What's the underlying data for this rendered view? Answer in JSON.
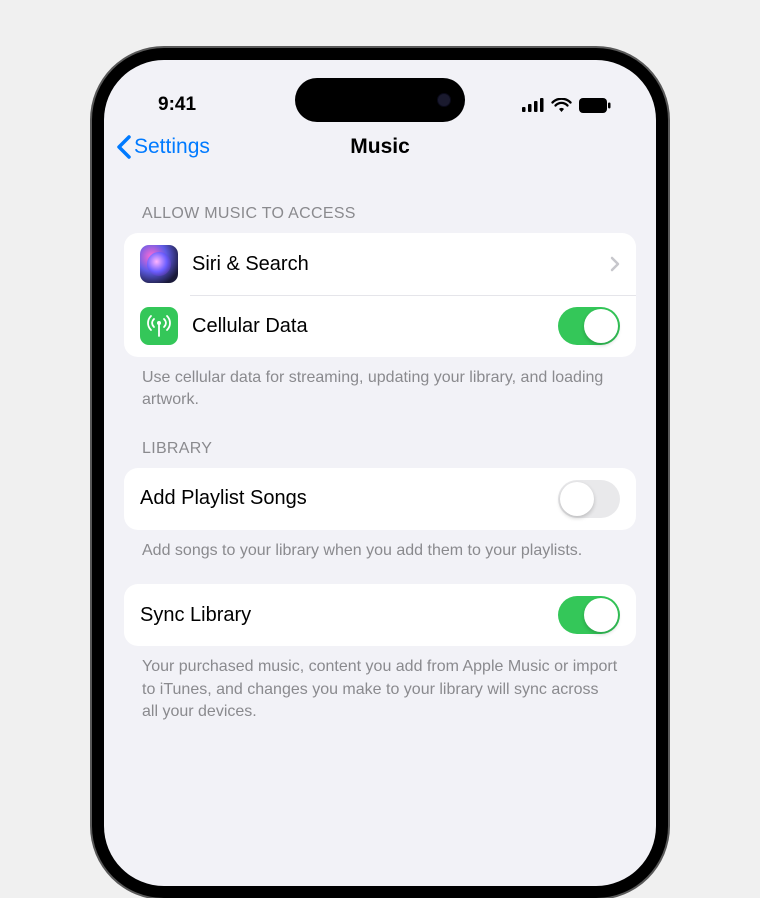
{
  "status_bar": {
    "time": "9:41"
  },
  "nav": {
    "back_label": "Settings",
    "title": "Music"
  },
  "sections": {
    "access": {
      "header": "ALLOW MUSIC TO ACCESS",
      "siri_label": "Siri & Search",
      "cellular_label": "Cellular Data",
      "cellular_on": true,
      "footer": "Use cellular data for streaming, updating your library, and loading artwork."
    },
    "library": {
      "header": "LIBRARY",
      "add_playlist_label": "Add Playlist Songs",
      "add_playlist_on": false,
      "add_playlist_footer": "Add songs to your library when you add them to your playlists.",
      "sync_label": "Sync Library",
      "sync_on": true,
      "sync_footer": "Your purchased music, content you add from Apple Music or import to iTunes, and changes you make to your library will sync across all your devices."
    }
  }
}
